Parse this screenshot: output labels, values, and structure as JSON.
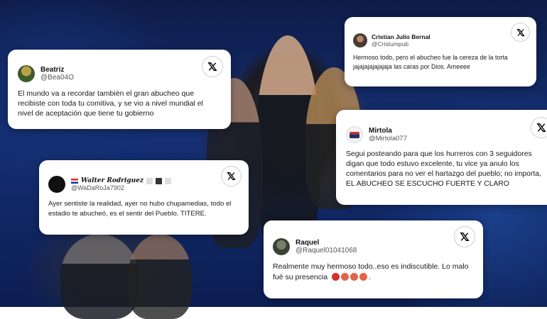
{
  "colors": {
    "card_bg": "#ffffff",
    "x_logo": "#000000",
    "backdrop": "#142f73"
  },
  "cards": [
    {
      "name": "Beatriz",
      "handle": "@Bea04O",
      "lines": [
        "El mundo va a recordar también el gran abucheo que",
        "recibiste con toda tu comitiva, y se vio a nivel mundial el",
        "nivel de aceptación que tiene tu gobierno"
      ]
    },
    {
      "name": "Cristian Julio Bernal",
      "handle": "@Cristumpub",
      "lines": [
        "Hermoso todo, pero el abucheo fue la cereza de la torta",
        "jajajajajajajaja las caras por Dios. Ameeee"
      ]
    },
    {
      "name": "Mirtola",
      "handle": "@Mirtola077",
      "lines": [
        "Segui posteando para que los hurreros con 3 seguidores",
        "digan que todo estuvo excelente, tu vice ya anulo los",
        "comentarios para no ver el hartazgo del pueblo; no importa,",
        "EL ABUCHEO SE ESCUCHO FUERTE Y CLARO"
      ]
    },
    {
      "name": "Walter Rodriguez",
      "handle": "@WaDaRoJa7902",
      "lines": [
        "Ayer sentiste la realidad, ayer no hubo chupamedias, todo el",
        "estadio te abucheó, es el sentir del Pueblo. TITERE."
      ]
    },
    {
      "name": "Raquel",
      "handle": "@Raquel01041068",
      "lines": [
        "Realmente muy hermoso todo..eso es indiscutible. Lo malo",
        "fué su presencia"
      ],
      "suffix": "."
    }
  ],
  "icons": {
    "x_logo": "x-logo-icon",
    "flag": "paraguay-flag-icon",
    "emoji": [
      "angry-face-icon",
      "devil-face-icon",
      "devil-face-icon",
      "devil-face-icon"
    ]
  }
}
